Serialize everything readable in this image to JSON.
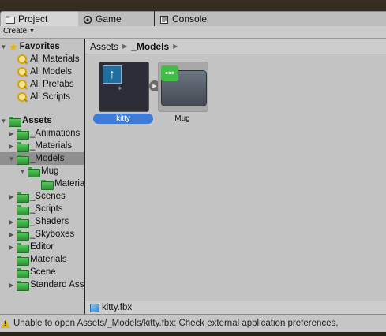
{
  "tabs": [
    {
      "label": "Project",
      "icon": "project-icon",
      "active": true
    },
    {
      "label": "Game",
      "icon": "game-icon",
      "active": false
    },
    {
      "label": "Console",
      "icon": "console-icon",
      "active": false
    }
  ],
  "toolbar": {
    "create_label": "Create"
  },
  "sidebar": {
    "favorites": {
      "label": "Favorites",
      "items": [
        "All Materials",
        "All Models",
        "All Prefabs",
        "All Scripts"
      ]
    },
    "assets": {
      "label": "Assets",
      "items": [
        {
          "label": "_Animations",
          "depth": 1,
          "expandable": true,
          "expanded": false,
          "selected": false
        },
        {
          "label": "_Materials",
          "depth": 1,
          "expandable": true,
          "expanded": false,
          "selected": false
        },
        {
          "label": "_Models",
          "depth": 1,
          "expandable": true,
          "expanded": true,
          "selected": true
        },
        {
          "label": "Mug",
          "depth": 2,
          "expandable": true,
          "expanded": true,
          "selected": false
        },
        {
          "label": "Materials",
          "depth": 3,
          "expandable": false,
          "expanded": false,
          "selected": false
        },
        {
          "label": "_Scenes",
          "depth": 1,
          "expandable": true,
          "expanded": false,
          "selected": false
        },
        {
          "label": "_Scripts",
          "depth": 1,
          "expandable": false,
          "expanded": false,
          "selected": false
        },
        {
          "label": "_Shaders",
          "depth": 1,
          "expandable": true,
          "expanded": false,
          "selected": false
        },
        {
          "label": "_Skyboxes",
          "depth": 1,
          "expandable": true,
          "expanded": false,
          "selected": false
        },
        {
          "label": "Editor",
          "depth": 1,
          "expandable": true,
          "expanded": false,
          "selected": false
        },
        {
          "label": "Materials",
          "depth": 1,
          "expandable": false,
          "expanded": false,
          "selected": false
        },
        {
          "label": "Scene",
          "depth": 1,
          "expandable": false,
          "expanded": false,
          "selected": false
        },
        {
          "label": "Standard Assets",
          "depth": 1,
          "expandable": true,
          "expanded": false,
          "selected": false
        }
      ]
    }
  },
  "breadcrumb": {
    "root": "Assets",
    "current": "_Models"
  },
  "assets": [
    {
      "name": "kitty",
      "selected": true,
      "icon": "model-icon"
    },
    {
      "name": "Mug",
      "selected": false,
      "icon": "prefab-icon"
    }
  ],
  "pathbar": {
    "file": "kitty.fbx",
    "icon": "fbx-file-icon"
  },
  "status": {
    "message": "Unable to open Assets/_Models/kitty.fbx: Check external application preferences.",
    "icon": "warning-icon"
  },
  "colors": {
    "folder": "#3aa040",
    "selection": "#3d7bd6",
    "warning": "#e6b800"
  }
}
